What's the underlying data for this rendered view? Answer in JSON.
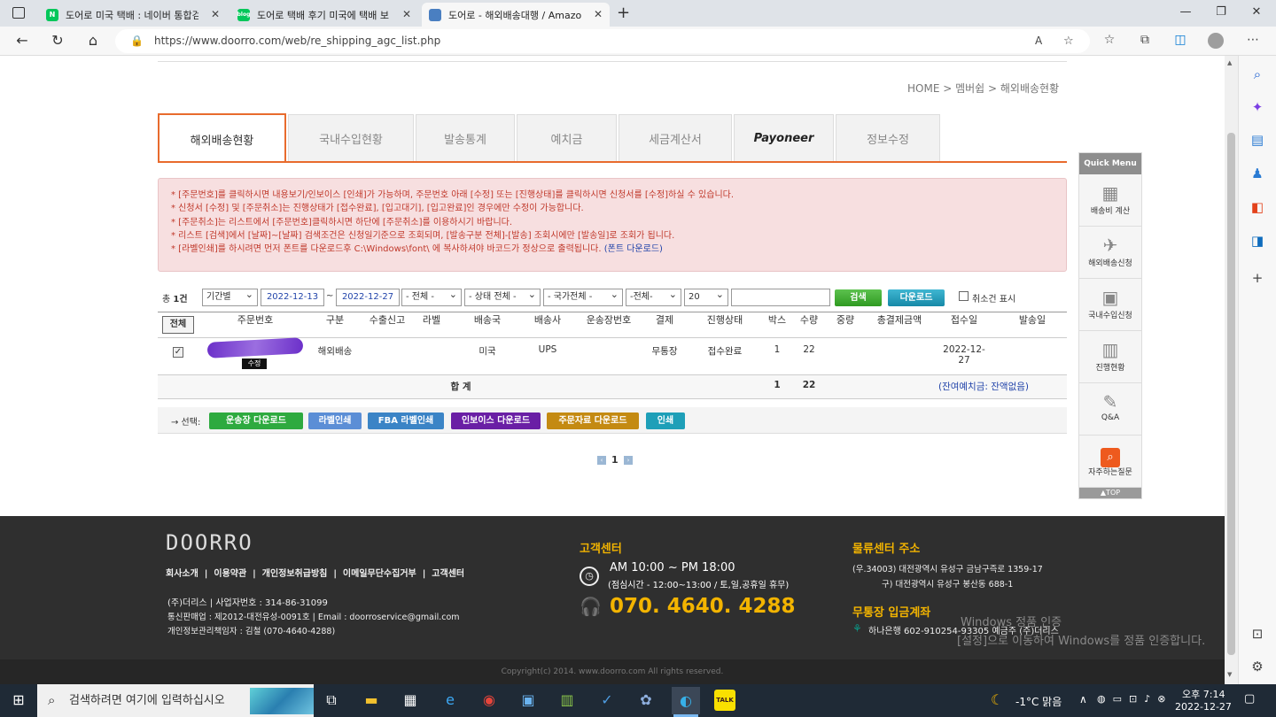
{
  "browser": {
    "tabs": [
      {
        "title": "도어로 미국 택배 : 네이버 통합검",
        "fav": "N",
        "color": "#03c75a"
      },
      {
        "title": "도어로 택배 후기 미국에 택배 보",
        "fav": "blog",
        "color": "#03c75a"
      },
      {
        "title": "도어로 - 해외배송대행 / Amazon",
        "fav": "",
        "color": "#4a7fc1"
      }
    ],
    "url": "https://www.doorro.com/web/re_shipping_agc_list.php"
  },
  "breadcrumb": "HOME > 멤버쉽 > 해외배송현황",
  "main_tabs": [
    "해외배송현황",
    "국내수입현황",
    "발송통계",
    "예치금",
    "세금계산서",
    "Payoneer",
    "정보수정"
  ],
  "notice": {
    "lines": [
      "* [주문번호]를 클릭하시면 내용보기/인보이스 [인쇄]가 가능하며, 주문번호 아래 [수정] 또는 [진행상태]를 클릭하시면 신청서를 [수정]하실 수 있습니다.",
      "* 신청서 [수정] 및 [주문취소]는 진행상태가 [접수완료], [입고대기], [입고완료]인 경우에만 수정이 가능합니다.",
      "* [주문취소]는 리스트에서 [주문번호]클릭하시면 하단에 [주문취소]를 이용하시기 바랍니다.",
      "* 리스트 [검색]에서 [날짜]~[날짜] 검색조건은 신청일기준으로 조회되며, [발송구분 전체]-[발송] 조회시에만 [발송일]로 조회가 됩니다.",
      "* [라벨인쇄]를 하시려면 먼저 폰트를 다운로드후 C:\\Windows\\font\\ 에 복사하셔야 바코드가 정상으로 출력됩니다."
    ],
    "font_link": "(폰트 다운로드)"
  },
  "filters": {
    "total_label": "총",
    "total_count": "1건",
    "period": "기간별",
    "date_from": "2022-12-13",
    "tilde": "~",
    "date_to": "2022-12-27",
    "all1": "- 전체 -",
    "status": "- 상태 전체 -",
    "country": "- 국가전체 -",
    "all2": "-전체-",
    "page_size": "20",
    "search_btn": "검색",
    "download_btn": "다운로드",
    "cancel_label": "취소건 표시"
  },
  "table": {
    "all_btn": "전체",
    "headers": [
      "주문번호",
      "구분",
      "수출신고",
      "라벨",
      "배송국",
      "배송사",
      "운송장번호",
      "결제",
      "진행상태",
      "박스",
      "수량",
      "중량",
      "총결제금액",
      "접수일",
      "발송일"
    ],
    "rows": [
      {
        "type": "해외배송",
        "country": "미국",
        "carrier": "UPS",
        "payment": "무통장",
        "status": "접수완료",
        "box": "1",
        "qty": "22",
        "date": "2022-12-27",
        "edit": "수정"
      }
    ],
    "total_label": "합 계",
    "total_box": "1",
    "total_qty": "22",
    "balance": "(잔여예치금: 잔액없음)"
  },
  "actions": {
    "select_label": "→ 선택:",
    "buttons": [
      {
        "label": "운송장 다운로드",
        "color": "#2eaa3f"
      },
      {
        "label": "라벨인쇄",
        "color": "#5b8ed6"
      },
      {
        "label": "FBA 라벨인쇄",
        "color": "#3b84c6"
      },
      {
        "label": "인보이스 다운로드",
        "color": "#6a1fa5"
      },
      {
        "label": "주문자료 다운로드",
        "color": "#c48a12"
      },
      {
        "label": "인쇄",
        "color": "#1e9fb8"
      }
    ]
  },
  "pager": {
    "current": "1"
  },
  "quick_menu": {
    "title": "Quick Menu",
    "items": [
      "배송비 계산",
      "해외배송신청",
      "국내수입신청",
      "진행현황",
      "Q&A",
      "자주하는질문"
    ],
    "top": "▲TOP"
  },
  "footer": {
    "logo": "DOORRO",
    "links": "회사소개  |  이용약관  |  개인정보취급방침  |  이메일무단수집거부  |  고객센터",
    "company": "(주)더리스  |  사업자번호 : 314-86-31099",
    "telecom": "통신판매업 : 제2012-대전유성-0091호  |  Email : doorroservice@gmail.com",
    "privacy": "개인정보관리책임자 : 김철 (070-4640-4288)",
    "cs_title": "고객센터",
    "hours": "AM 10:00 ~ PM 18:00",
    "lunch": "(점심시간 - 12:00~13:00 / 토,일,공휴일 휴무)",
    "phone": "070. 4640. 4288",
    "addr_title": "물류센터 주소",
    "addr1": "(우.34003) 대전광역시 유성구 금남구즉로 1359-17",
    "addr2": "구) 대전광역시 유성구 봉산동 688-1",
    "bank_title": "무통장 입금계좌",
    "bank": "하나은행  602-910254-93305 예금주 (주)더리스",
    "copyright": "Copyright(c) 2014. www.doorro.com All rights reserved."
  },
  "watermark": {
    "line1": "Windows 정품 인증",
    "line2": "[설정]으로 이동하여 Windows를 정품 인증합니다."
  },
  "taskbar": {
    "search_placeholder": "검색하려면 여기에 입력하십시오",
    "weather": "-1°C  맑음",
    "time": "오후 7:14",
    "date": "2022-12-27"
  }
}
